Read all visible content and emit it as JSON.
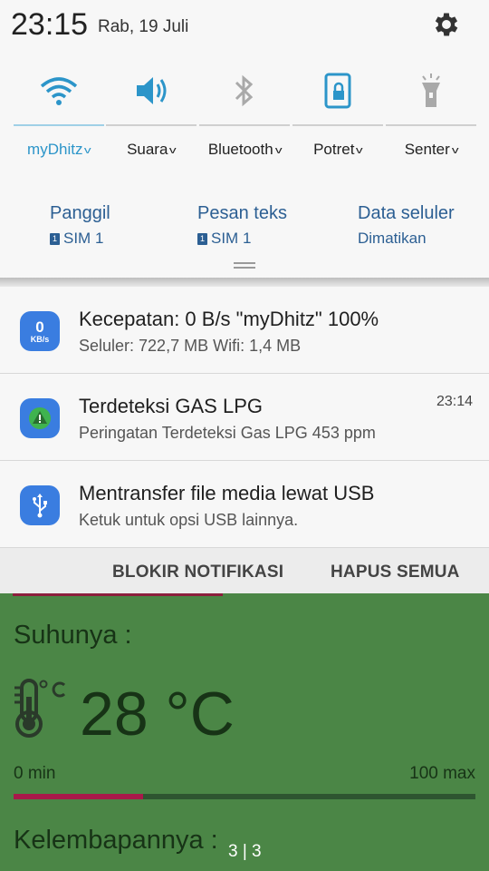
{
  "status": {
    "time": "23:15",
    "date": "Rab, 19 Juli"
  },
  "quick_toggles": [
    {
      "label": "myDhitz",
      "icon": "wifi-icon",
      "active": true
    },
    {
      "label": "Suara",
      "icon": "speaker-icon",
      "active": false
    },
    {
      "label": "Bluetooth",
      "icon": "bluetooth-icon",
      "active": false
    },
    {
      "label": "Potret",
      "icon": "rotation-lock-icon",
      "active": false
    },
    {
      "label": "Senter",
      "icon": "flashlight-icon",
      "active": false
    }
  ],
  "sim": {
    "call": {
      "title": "Panggil",
      "sim": "SIM 1"
    },
    "sms": {
      "title": "Pesan teks",
      "sim": "SIM 1"
    },
    "data": {
      "title": "Data seluler",
      "status": "Dimatikan"
    },
    "badge": "1"
  },
  "notifications": [
    {
      "icon": "network-speed-icon",
      "icon_top": "0",
      "icon_bottom": "KB/s",
      "title": "Kecepatan: 0 B/s   \"myDhitz\" 100%",
      "text": "Seluler: 722,7 MB   Wifi: 1,4 MB",
      "time": ""
    },
    {
      "icon": "gas-alert-icon",
      "title": "Terdeteksi GAS LPG",
      "text": "Peringatan Terdeteksi Gas LPG 453 ppm",
      "time": "23:14"
    },
    {
      "icon": "usb-icon",
      "title": "Mentransfer file media lewat USB",
      "text": "Ketuk untuk opsi USB lainnya.",
      "time": ""
    }
  ],
  "actions": {
    "block": "BLOKIR NOTIFIKASI",
    "clear": "HAPUS SEMUA"
  },
  "app": {
    "temp_label": "Suhunya :",
    "temp_value": "28 °C",
    "min_label": "0 min",
    "max_label": "100 max",
    "temp_fraction": 0.28,
    "humidity_label": "Kelembapannya :",
    "page_indicator": "3 | 3"
  },
  "colors": {
    "accent": "#2c95c9",
    "app_bg": "#4b8646",
    "bar_fill": "#a8194a",
    "sim_blue": "#2c5f93"
  }
}
